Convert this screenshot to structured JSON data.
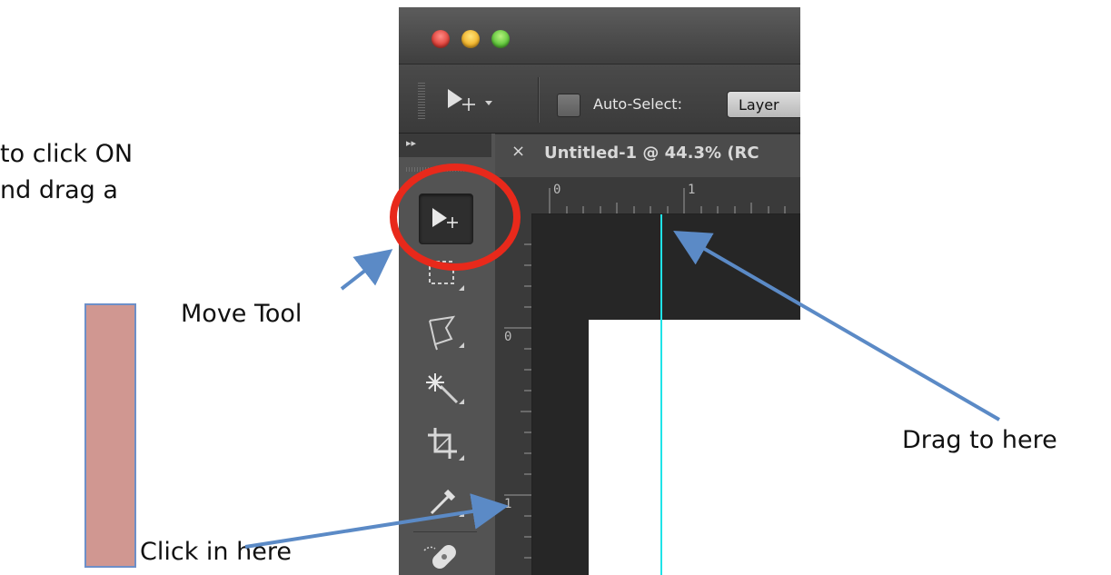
{
  "annotations": {
    "cropped_text_line1": "to click ON",
    "cropped_text_line2": "nd drag a",
    "move_tool_label": "Move Tool",
    "drag_label": "Drag to here",
    "click_label": "Click in here",
    "colors": {
      "arrow": "#5b8ac6",
      "highlight_circle": "#e8291b",
      "guide_line": "#1fe3e8",
      "ruler_highlight_fill": "#aa4137"
    }
  },
  "window": {
    "traffic_lights": [
      "close",
      "minimize",
      "zoom"
    ]
  },
  "options_bar": {
    "tool_icon": "move-tool-icon",
    "auto_select_checked": false,
    "auto_select_label": "Auto-Select:",
    "auto_select_value": "Layer"
  },
  "document": {
    "tab_title": "Untitled-1 @ 44.3% (RC",
    "tab_close": "×",
    "ruler_h_labels": [
      "0",
      "1"
    ],
    "ruler_v_labels": [
      "0",
      "1"
    ]
  },
  "toolbox": {
    "collapse_glyph": "▸▸",
    "tools": [
      "move-tool",
      "marquee-tool",
      "lasso-tool",
      "magic-wand-tool",
      "crop-tool",
      "eyedropper-tool",
      "healing-tool"
    ],
    "selected": "move-tool"
  }
}
